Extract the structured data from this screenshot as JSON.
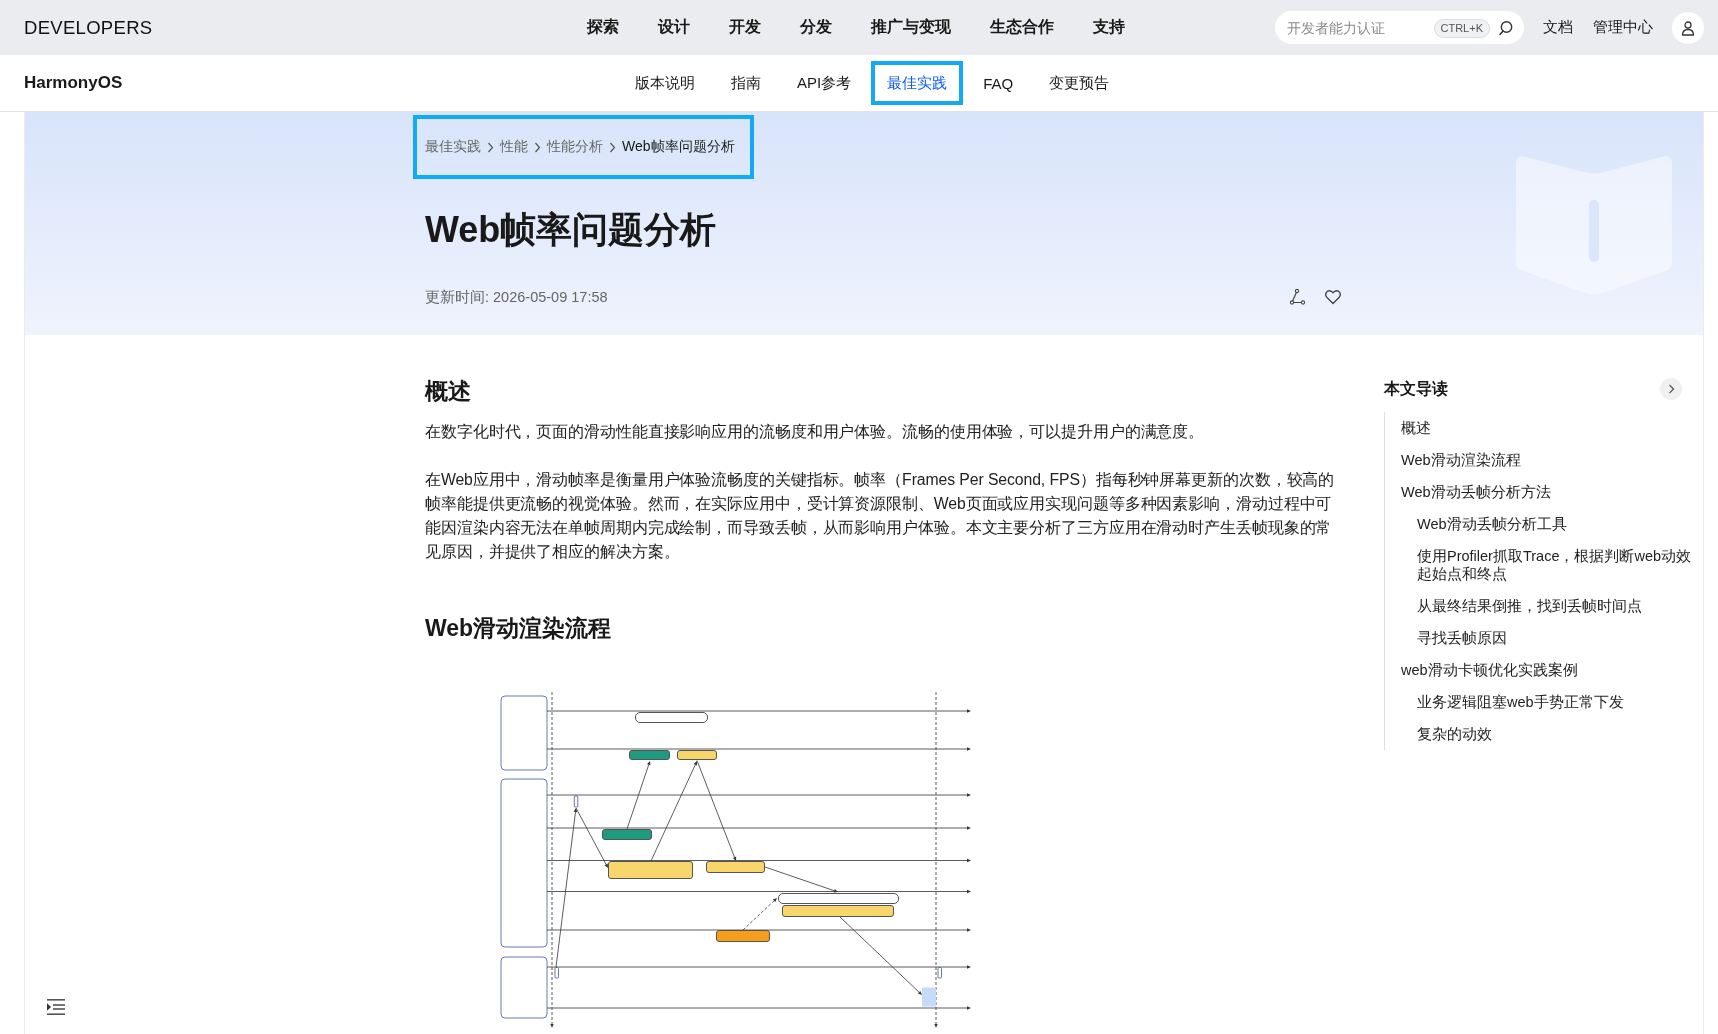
{
  "top_bar": {
    "logo": "DEVELOPERS",
    "nav": [
      "探索",
      "设计",
      "开发",
      "分发",
      "推广与变现",
      "生态合作",
      "支持"
    ],
    "search": {
      "placeholder": "开发者能力认证",
      "shortcut": "CTRL+K"
    },
    "links": [
      "文档",
      "管理中心"
    ]
  },
  "sub_bar": {
    "product": "HarmonyOS",
    "tabs": [
      {
        "label": "版本说明",
        "selected": false,
        "highlighted": false
      },
      {
        "label": "指南",
        "selected": false,
        "highlighted": false
      },
      {
        "label": "API参考",
        "selected": false,
        "highlighted": false
      },
      {
        "label": "最佳实践",
        "selected": true,
        "highlighted": true
      },
      {
        "label": "FAQ",
        "selected": false,
        "highlighted": false
      },
      {
        "label": "变更预告",
        "selected": false,
        "highlighted": false
      }
    ]
  },
  "hero": {
    "breadcrumb": {
      "highlighted": true,
      "items": [
        "最佳实践",
        "性能",
        "性能分析",
        "Web帧率问题分析"
      ]
    },
    "title": "Web帧率问题分析",
    "updated": "更新时间: 2026-05-09 17:58"
  },
  "article": {
    "sections": [
      {
        "heading": "概述",
        "paragraphs": [
          "在数字化时代，页面的滑动性能直接影响应用的流畅度和用户体验。流畅的使用体验，可以提升用户的满意度。",
          "在Web应用中，滑动帧率是衡量用户体验流畅度的关键指标。帧率（Frames Per Second, FPS）指每秒钟屏幕更新的次数，较高的帧率能提供更流畅的视觉体验。然而，在实际应用中，受计算资源限制、Web页面或应用实现问题等多种因素影响，滑动过程中可能因渲染内容无法在单帧周期内完成绘制，而导致丢帧，从而影响用户体验。本文主要分析了三方应用在滑动时产生丢帧现象的常见原因，并提供了相应的解决方案。"
        ]
      },
      {
        "heading": "Web滑动渲染流程",
        "figure": {
          "boxes": [
            {
              "color": "#ffffff"
            },
            {
              "color": "#1f9a80"
            },
            {
              "color": "#f9d66b"
            },
            {
              "color": "#1f9a80"
            },
            {
              "color": "#f9d66b"
            },
            {
              "color": "#f9d66b"
            },
            {
              "color": "#ffffff"
            },
            {
              "color": "#f9d66b"
            },
            {
              "color": "#f59e1b"
            }
          ]
        }
      }
    ]
  },
  "toc": {
    "title": "本文导读",
    "items": [
      {
        "label": "概述"
      },
      {
        "label": "Web滑动渲染流程"
      },
      {
        "label": "Web滑动丢帧分析方法",
        "children": [
          {
            "label": "Web滑动丢帧分析工具"
          },
          {
            "label": "使用Profiler抓取Trace，根据判断web动效起始点和终点"
          },
          {
            "label": "从最终结果倒推，找到丢帧时间点"
          },
          {
            "label": "寻找丢帧原因"
          }
        ]
      },
      {
        "label": "web滑动卡顿优化实践案例",
        "children": [
          {
            "label": "业务逻辑阻塞web手势正常下发"
          },
          {
            "label": "复杂的动效"
          }
        ]
      }
    ]
  }
}
